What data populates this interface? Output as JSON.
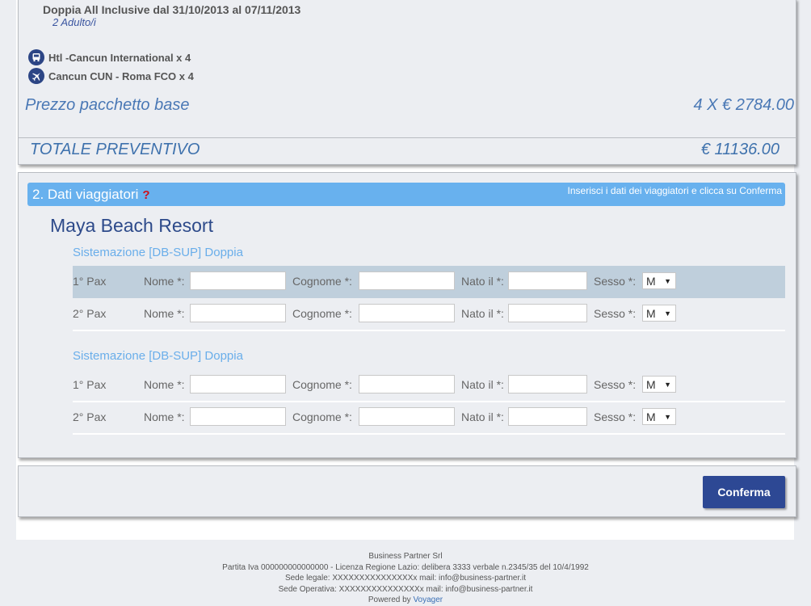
{
  "summary": {
    "room_line": "Doppia  All Inclusive dal 31/10/2013 al 07/11/2013",
    "adults": "2 Adulto/i",
    "services": [
      {
        "icon": "bus-icon",
        "label": "Htl -Cancun International x 4"
      },
      {
        "icon": "plane-icon",
        "label": "Cancun CUN - Roma FCO x 4"
      }
    ],
    "base_price_label": "Prezzo pacchetto base",
    "base_price_value": "4 X € 2784.00",
    "total_label": "TOTALE PREVENTIVO",
    "total_value": "€ 11136.00"
  },
  "travelers": {
    "section_title": "2. Dati viaggiatori",
    "help_mark": "?",
    "hint": "Inserisci i dati dei viaggiatori e clicca su Conferma",
    "hotel_name": "Maya Beach Resort",
    "labels": {
      "nome": "Nome *:",
      "cognome": "Cognome *:",
      "nato": "Nato il *:",
      "sesso": "Sesso *:"
    },
    "rooms": [
      {
        "title": "Sistemazione [DB-SUP] Doppia",
        "pax": [
          {
            "label": "1° Pax",
            "nome": "",
            "cognome": "",
            "nato": "",
            "sesso": "M"
          },
          {
            "label": "2° Pax",
            "nome": "",
            "cognome": "",
            "nato": "",
            "sesso": "M"
          }
        ]
      },
      {
        "title": "Sistemazione [DB-SUP] Doppia",
        "pax": [
          {
            "label": "1° Pax",
            "nome": "",
            "cognome": "",
            "nato": "",
            "sesso": "M"
          },
          {
            "label": "2° Pax",
            "nome": "",
            "cognome": "",
            "nato": "",
            "sesso": "M"
          }
        ]
      }
    ]
  },
  "actions": {
    "confirm_label": "Conferma"
  },
  "footer": {
    "company": "Business Partner Srl",
    "vat_line": "Partita Iva 000000000000000 - Licenza Regione Lazio: delibera 3333 verbale n.2345/35 del 10/4/1992",
    "legal_seat": "Sede legale: XXXXXXXXXXXXXXXx mail: info@business-partner.it",
    "operative_seat": "Sede Operativa: XXXXXXXXXXXXXXXx mail: info@business-partner.it",
    "powered_prefix": "Powered by",
    "powered_brand": "Voyager"
  },
  "colors": {
    "header_bar": "#68b1ee",
    "confirm_button": "#2d4894",
    "price_text": "#4a78b5",
    "room_title": "#6aaeea",
    "hotel_name": "#2d4a8a",
    "shaded_row": "#bfcfdc"
  }
}
